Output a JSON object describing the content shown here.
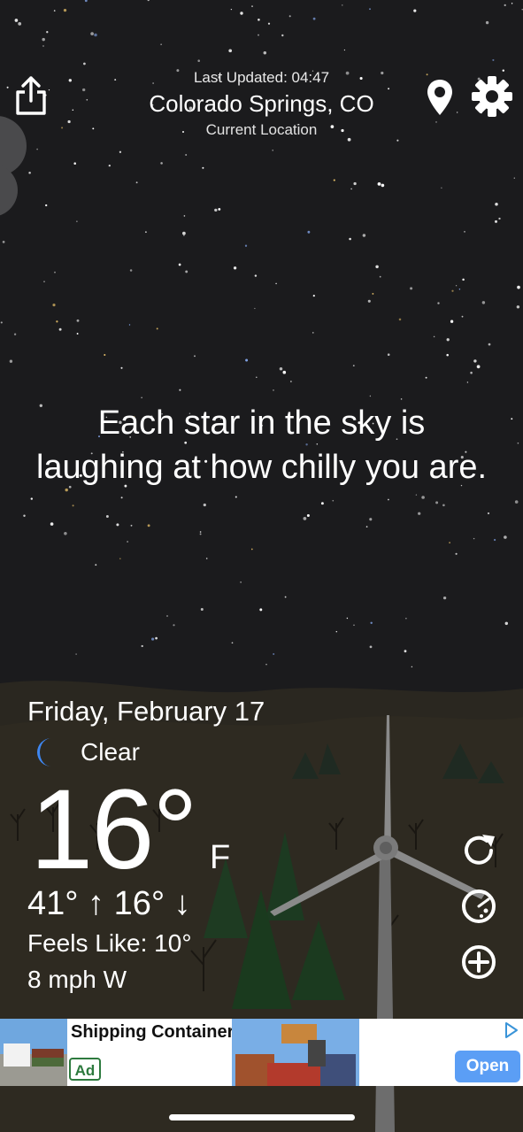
{
  "header": {
    "last_updated": "Last Updated: 04:47",
    "location": "Colorado Springs, CO",
    "location_sub": "Current Location"
  },
  "icons": {
    "share": "share-icon",
    "location": "map-pin-icon",
    "settings": "gear-icon",
    "condition": "crescent-moon-icon",
    "refresh": "refresh-icon",
    "radar": "radar-icon",
    "add": "add-circle-icon"
  },
  "message": "Each star in the sky is laughing at how chilly you are.",
  "weather": {
    "date": "Friday, February 17",
    "condition": "Clear",
    "temperature": "16°",
    "unit": "F",
    "high_low": "41° ↑  16° ↓",
    "feels_like": "Feels Like: 10°",
    "wind": "8 mph W"
  },
  "ad": {
    "title": "Shipping Containers for Sale",
    "badge": "Ad",
    "cta": "Open"
  },
  "colors": {
    "sky": "#1b1b1d",
    "hill": "#2e2b22",
    "moon": "#3e86f0",
    "ad_button": "#5b9ef5"
  }
}
